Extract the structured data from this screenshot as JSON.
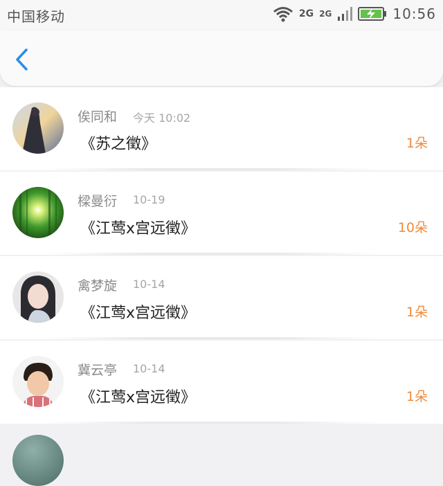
{
  "status_bar": {
    "carrier": "中国移动",
    "network_1": "2G",
    "network_2": "2G",
    "time": "10:56",
    "icons": [
      "wifi-icon",
      "signal-icon",
      "battery-charging-icon"
    ]
  },
  "header": {
    "back_icon": "chevron-left-icon"
  },
  "list": [
    {
      "name": "俟同和",
      "time": "今天 10:02",
      "work": "《苏之徵》",
      "count": "1朵"
    },
    {
      "name": "樑曼衍",
      "time": "10-19",
      "work": "《江莺x宫远徵》",
      "count": "10朵"
    },
    {
      "name": "禽梦旋",
      "time": "10-14",
      "work": "《江莺x宫远徵》",
      "count": "1朵"
    },
    {
      "name": "冀云亭",
      "time": "10-14",
      "work": "《江莺x宫远徵》",
      "count": "1朵"
    }
  ],
  "colors": {
    "accent": "#2a8ee6",
    "count": "#f08a3a"
  }
}
